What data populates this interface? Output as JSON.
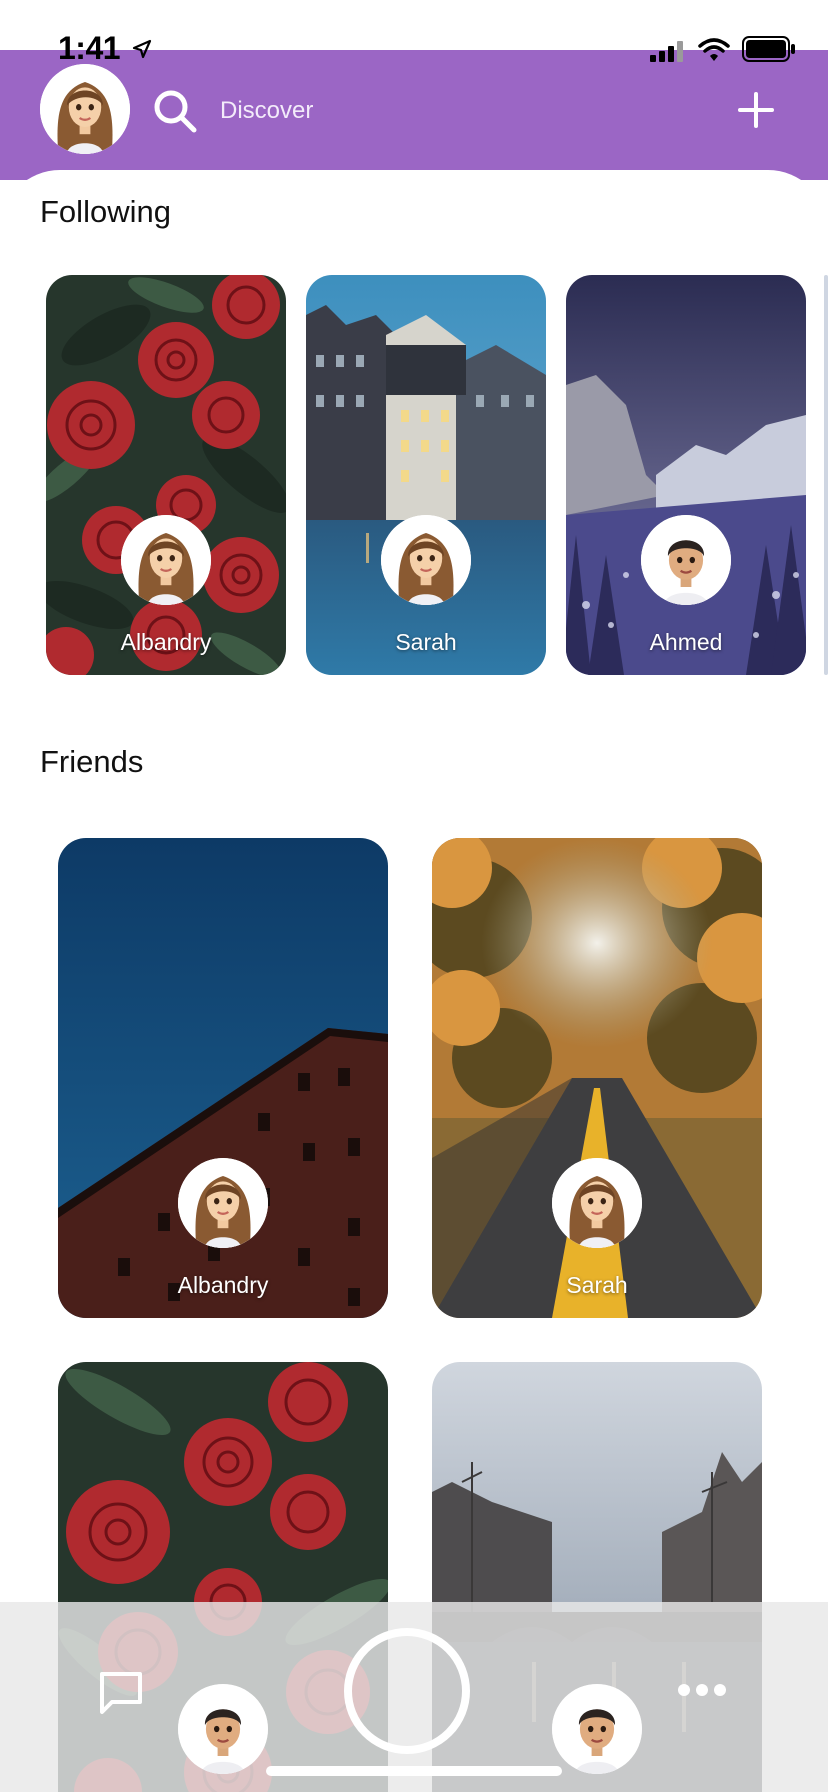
{
  "status_bar": {
    "time": "1:41"
  },
  "header": {
    "discover_label": "Discover"
  },
  "following": {
    "title": "Following",
    "cards": [
      {
        "name": "Albandry",
        "avatar": "female-avatar-icon",
        "background": "red-roses-photo"
      },
      {
        "name": "Sarah",
        "avatar": "female-avatar-icon",
        "background": "canal-houses-photo"
      },
      {
        "name": "Ahmed",
        "avatar": "male-avatar-icon",
        "background": "snowy-valley-photo"
      }
    ]
  },
  "friends": {
    "title": "Friends",
    "cards": [
      {
        "name": "Albandry",
        "avatar": "female-avatar-icon",
        "background": "brick-building-sky-photo"
      },
      {
        "name": "Sarah",
        "avatar": "female-avatar-icon",
        "background": "autumn-road-photo"
      },
      {
        "name": "",
        "background": "red-roses-photo"
      },
      {
        "name": "",
        "background": "canal-bridge-photo"
      }
    ]
  },
  "colors": {
    "header": "#9b66c5",
    "text": "#111111"
  }
}
